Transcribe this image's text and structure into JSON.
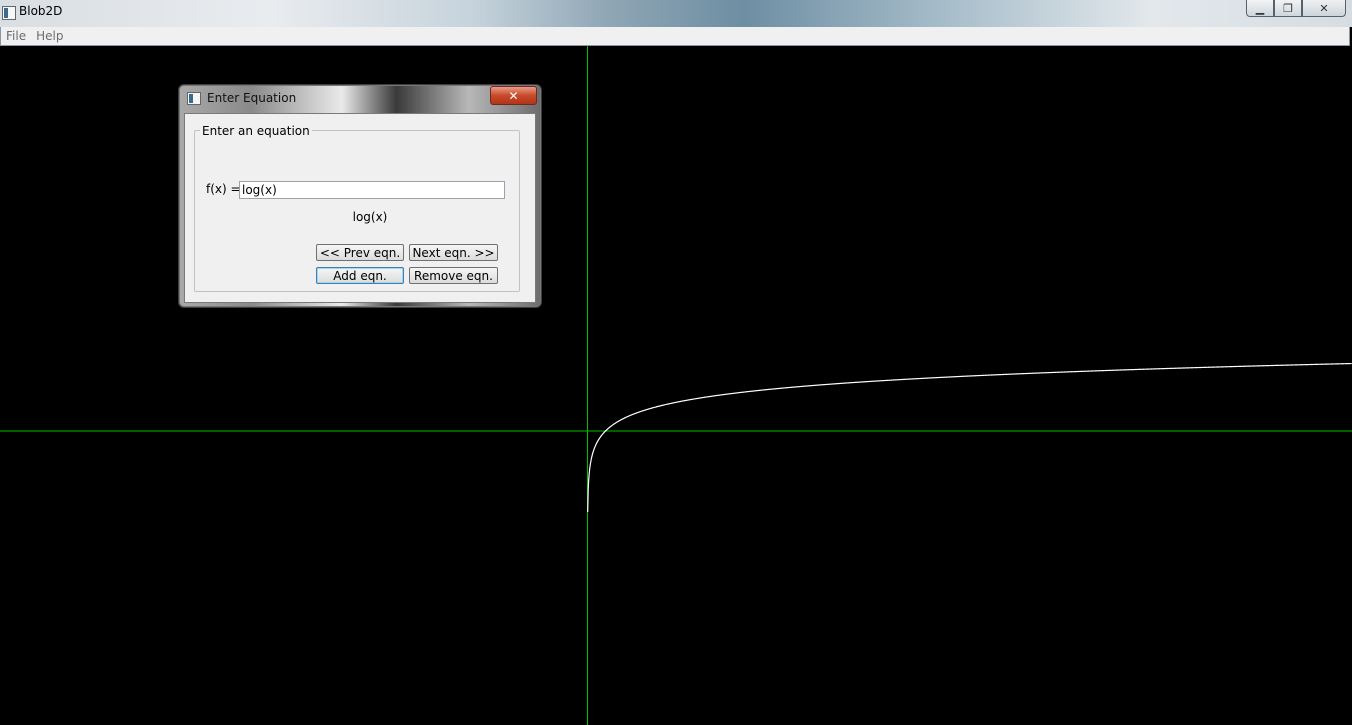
{
  "window": {
    "title": "Blob2D",
    "controls": {
      "minimize": "▁",
      "maximize": "❐",
      "close": "✕"
    }
  },
  "menubar": {
    "items": [
      "File",
      "Help"
    ]
  },
  "dialog": {
    "title": "Enter Equation",
    "close_glyph": "✕",
    "group_label": "Enter an equation",
    "fx_label": "f(x) =",
    "equation_value": "log(x)",
    "equation_preview": "log(x)",
    "buttons": {
      "prev": "<< Prev eqn.",
      "next": "Next eqn. >>",
      "add": "Add eqn.",
      "remove": "Remove eqn."
    }
  },
  "plot": {
    "function": "log(x)",
    "axis_color": "#00c000",
    "curve_color": "#ffffff",
    "background": "#000000"
  }
}
